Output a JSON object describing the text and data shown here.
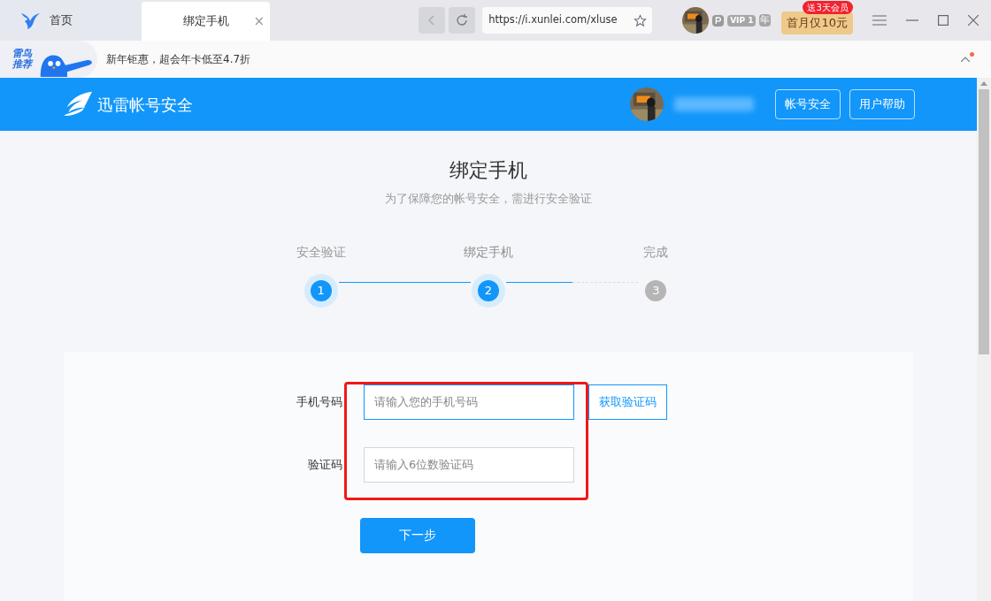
{
  "browser": {
    "tabs": [
      {
        "label": "首页",
        "selected": false
      },
      {
        "label": "绑定手机",
        "selected": true,
        "close": "×"
      }
    ],
    "address": "https://i.xunlei.com/xluse",
    "vip_badge": "VIP 1",
    "vip_year": "年",
    "promo_button": "首月仅10元",
    "promo_badge": "送3天会员"
  },
  "promo_bar": {
    "banner_label": "雷鸟推荐",
    "text": "新年钜惠，超会年卡低至4.7折",
    "notification": true
  },
  "header": {
    "title": "迅雷帐号安全",
    "buttons": [
      "帐号安全",
      "用户帮助"
    ]
  },
  "page": {
    "title": "绑定手机",
    "subtitle": "为了保障您的帐号安全，需进行安全验证"
  },
  "steps": [
    {
      "label": "安全验证",
      "number": "1",
      "done": true,
      "current": false
    },
    {
      "label": "绑定手机",
      "number": "2",
      "done": false,
      "current": true
    },
    {
      "label": "完成",
      "number": "3",
      "done": false,
      "current": false
    }
  ],
  "form": {
    "highlighted": true,
    "fields": [
      {
        "label": "手机号码",
        "placeholder": "请输入您的手机号码",
        "focused": true
      },
      {
        "label": "验证码",
        "placeholder": "请输入6位数验证码",
        "focused": false
      }
    ],
    "code_button": "获取验证码",
    "submit": "下一步"
  }
}
